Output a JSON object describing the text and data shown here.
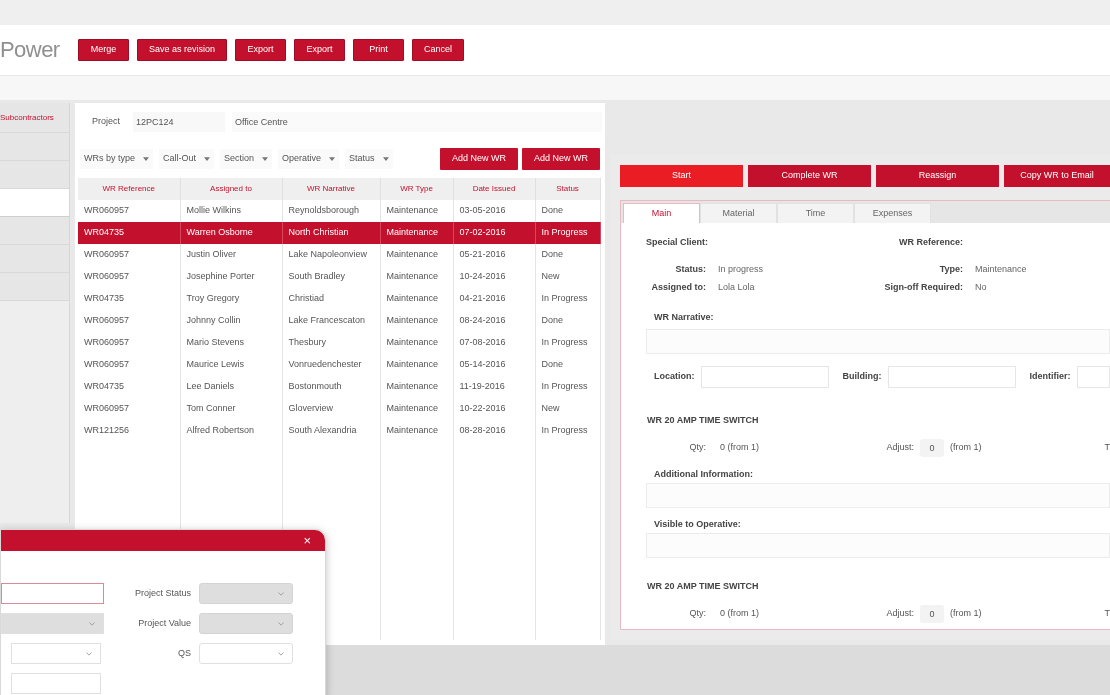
{
  "app": {
    "logo": "Power"
  },
  "toolbar": {
    "buttons": [
      "Merge",
      "Save as revision",
      "Export",
      "Export",
      "Print",
      "Cancel"
    ]
  },
  "sidebar": {
    "items": [
      {
        "label": "Subcontractors",
        "selected": false
      },
      {
        "selected": false
      },
      {
        "selected": false
      },
      {
        "selected": true
      },
      {
        "selected": false
      },
      {
        "selected": false
      },
      {
        "selected": false
      }
    ]
  },
  "project": {
    "label": "Project",
    "code": "12PC124",
    "name": "Office Centre"
  },
  "filters": [
    "WRs by type",
    "Call-Out",
    "Section",
    "Operative",
    "Status"
  ],
  "add_buttons": [
    "Add New WR",
    "Add New WR"
  ],
  "table": {
    "columns": [
      "WR Reference",
      "Assigned to",
      "WR Narrative",
      "WR Type",
      "Date Issued",
      "Status"
    ],
    "rows": [
      {
        "cells": [
          "WR060957",
          "Mollie Wilkins",
          "Reynoldsborough",
          "Maintenance",
          "03-05-2016",
          "Done"
        ],
        "selected": false
      },
      {
        "cells": [
          "WR04735",
          "Warren Osborne",
          "North Christian",
          "Maintenance",
          "07-02-2016",
          "In Progress"
        ],
        "selected": true
      },
      {
        "cells": [
          "WR060957",
          "Justin Oliver",
          "Lake Napoleonview",
          "Maintenance",
          "05-21-2016",
          "Done"
        ],
        "selected": false
      },
      {
        "cells": [
          "WR060957",
          "Josephine Porter",
          "South Bradley",
          "Maintenance",
          "10-24-2016",
          "New"
        ],
        "selected": false
      },
      {
        "cells": [
          "WR04735",
          "Troy Gregory",
          "Christiad",
          "Maintenance",
          "04-21-2016",
          "In Progress"
        ],
        "selected": false
      },
      {
        "cells": [
          "WR060957",
          "Johnny Collin",
          "Lake Francescaton",
          "Maintenance",
          "08-24-2016",
          "Done"
        ],
        "selected": false
      },
      {
        "cells": [
          "WR060957",
          "Mario Stevens",
          "Thesbury",
          "Maintenance",
          "07-08-2016",
          "In Progress"
        ],
        "selected": false
      },
      {
        "cells": [
          "WR060957",
          "Maurice Lewis",
          "Vonruedenchester",
          "Maintenance",
          "05-14-2016",
          "Done"
        ],
        "selected": false
      },
      {
        "cells": [
          "WR04735",
          "Lee Daniels",
          "Bostonmouth",
          "Maintenance",
          "11-19-2016",
          "In Progress"
        ],
        "selected": false
      },
      {
        "cells": [
          "WR060957",
          "Tom Conner",
          "Gloverview",
          "Maintenance",
          "10-22-2016",
          "New"
        ],
        "selected": false
      },
      {
        "cells": [
          "WR121256",
          "Alfred Robertson",
          "South Alexandria",
          "Maintenance",
          "08-28-2016",
          "In Progress"
        ],
        "selected": false
      }
    ]
  },
  "detail": {
    "actions": [
      {
        "label": "Start",
        "kind": "primary"
      },
      {
        "label": "Complete WR",
        "kind": "secondary"
      },
      {
        "label": "Reassign",
        "kind": "secondary"
      },
      {
        "label": "Copy WR to Email",
        "kind": "secondary"
      }
    ],
    "tabs": [
      {
        "label": "Main",
        "selected": true
      },
      {
        "label": "Material",
        "selected": false
      },
      {
        "label": "Time",
        "selected": false
      },
      {
        "label": "Expenses",
        "selected": false
      }
    ],
    "header_labels": [
      "Special Client:",
      "WR Reference:"
    ],
    "info": [
      {
        "label": "Status:",
        "value": "In progress"
      },
      {
        "label": "Type:",
        "value": "Maintenance"
      },
      {
        "label": "Assigned to:",
        "value": "Lola Lola"
      },
      {
        "label": "Sign-off Required:",
        "value": "No"
      }
    ],
    "narrative_label": "WR Narrative:",
    "location_fields": [
      "Location:",
      "Building:",
      "Identifier:"
    ],
    "sections": [
      {
        "kind": "item",
        "title": "WR 20 AMP TIME SWITCH",
        "qty_label": "Qty:",
        "qty_value": "0 (from 1)",
        "adjust_label": "Adjust:",
        "adjust_value": "0",
        "adjust_from": "(from 1)",
        "column_3": "T"
      },
      {
        "kind": "note",
        "label": "Additional Information:"
      },
      {
        "kind": "note",
        "label": "Visible to Operative:"
      },
      {
        "kind": "item",
        "title": "WR 20 AMP TIME SWITCH",
        "qty_label": "Qty:",
        "qty_value": "0 (from 1)",
        "adjust_label": "Adjust:",
        "adjust_value": "0",
        "adjust_from": "(from 1)",
        "column_3": "T"
      }
    ]
  },
  "dialog": {
    "close": "×",
    "left_fields": [
      {
        "kind": "input",
        "focused": true,
        "disabled": false
      },
      {
        "kind": "select",
        "focused": false,
        "disabled": true
      },
      {
        "kind": "select",
        "focused": false,
        "disabled": false
      },
      {
        "kind": "input",
        "focused": false,
        "disabled": false
      }
    ],
    "right_fields": [
      {
        "label": "Project Status",
        "disabled": true
      },
      {
        "label": "Project Value",
        "disabled": true
      },
      {
        "label": "QS",
        "disabled": false
      }
    ]
  }
}
